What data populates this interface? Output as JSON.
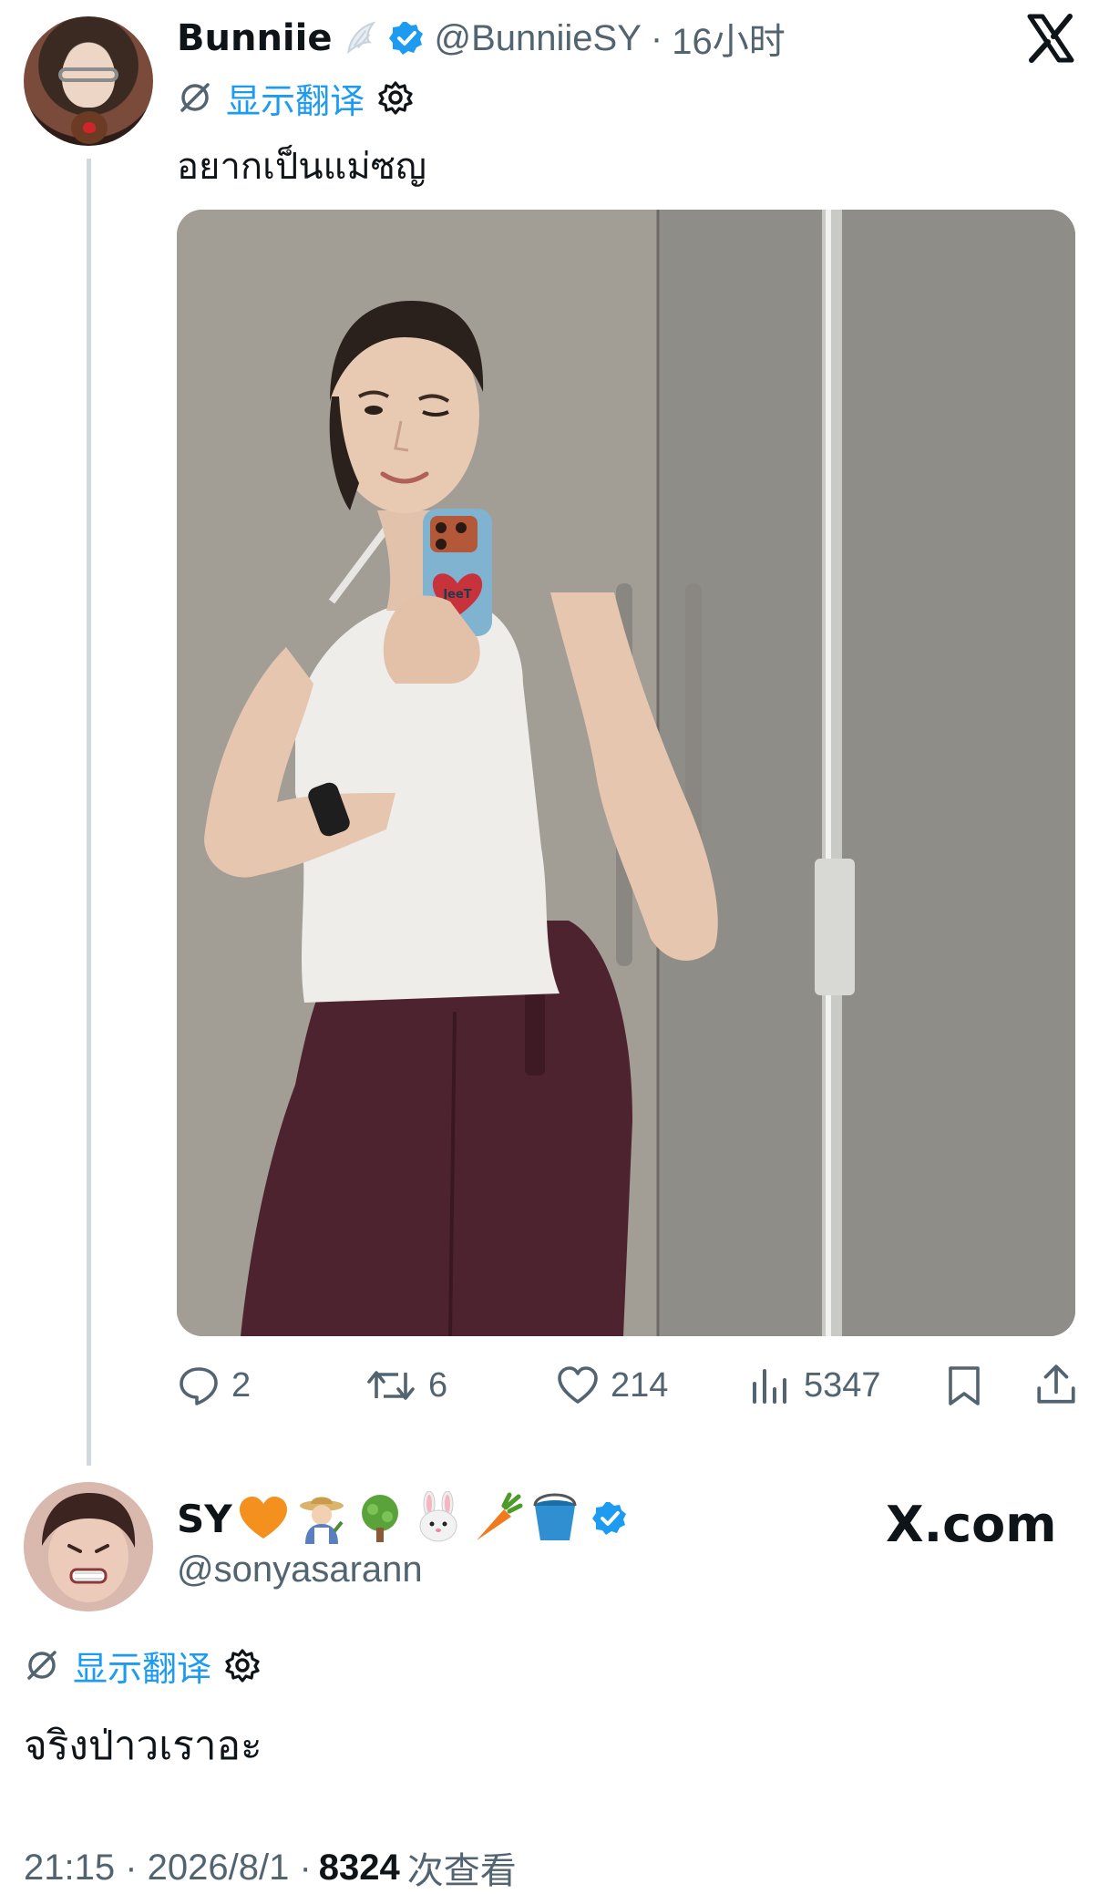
{
  "parent_tweet": {
    "author_name": "Bunniie",
    "handle": "@BunniieSY",
    "separator": "·",
    "time": "16小时",
    "translate_label": "显示翻译",
    "text": "อยากเป็นแม่ซญ",
    "photo_phone_case_text": "JeeT",
    "actions": {
      "replies": "2",
      "reposts": "6",
      "likes": "214",
      "views": "5347"
    }
  },
  "reply_tweet": {
    "author_name": "SY",
    "handle": "@sonyasarann",
    "translate_label": "显示翻译",
    "text": "จริงป่าวเราอะ",
    "timestamp": "21:15 · 2026/8/1 ·",
    "views_count": "8324",
    "views_label": "次查看"
  },
  "watermark": {
    "x_com": "X.com"
  },
  "icons": {
    "verified": "verified-badge-icon",
    "close": "x-logo-icon",
    "translate": "translate-icon",
    "settings": "gear-icon",
    "reply": "reply-icon",
    "repost": "repost-icon",
    "like": "heart-icon",
    "views": "bar-chart-icon",
    "bookmark": "bookmark-icon",
    "share": "share-icon"
  },
  "colors": {
    "text": "#0f1419",
    "secondary": "#536471",
    "link": "#1d9bf0",
    "verified": "#1d9bf0",
    "thread_line": "#cfd9de"
  }
}
